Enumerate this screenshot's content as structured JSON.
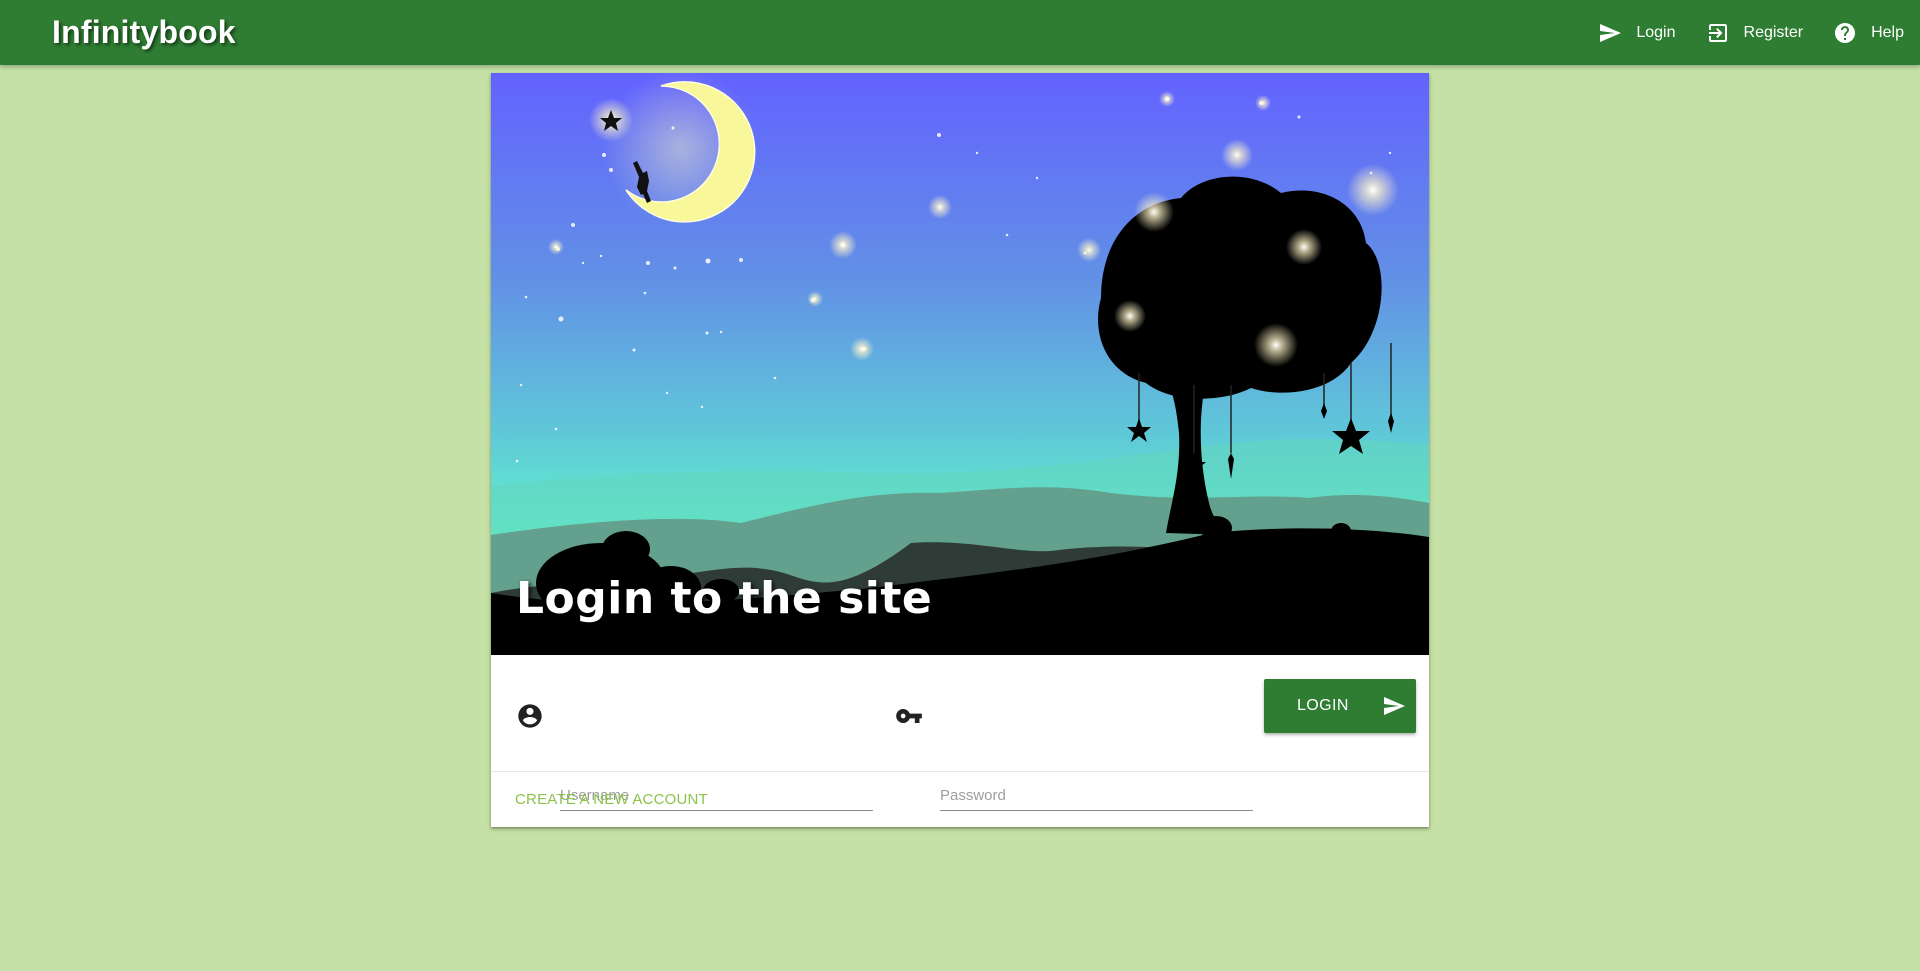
{
  "app": {
    "brand": "Infinitybook"
  },
  "nav": {
    "items": [
      {
        "label": "Login",
        "icon": "send-icon"
      },
      {
        "label": "Register",
        "icon": "login-arrow-icon"
      },
      {
        "label": "Help",
        "icon": "help-circle-icon"
      }
    ]
  },
  "hero": {
    "title": "Login to the site"
  },
  "form": {
    "username_placeholder": "Username",
    "password_placeholder": "Password",
    "username_icon": "account-circle-icon",
    "password_icon": "key-icon",
    "login_button": "LOGIN"
  },
  "footer": {
    "create_account": "CREATE A NEW ACCOUNT"
  },
  "colors": {
    "primary": "#2e7d32",
    "background": "#c5e1a5",
    "link": "#8bc34a"
  }
}
